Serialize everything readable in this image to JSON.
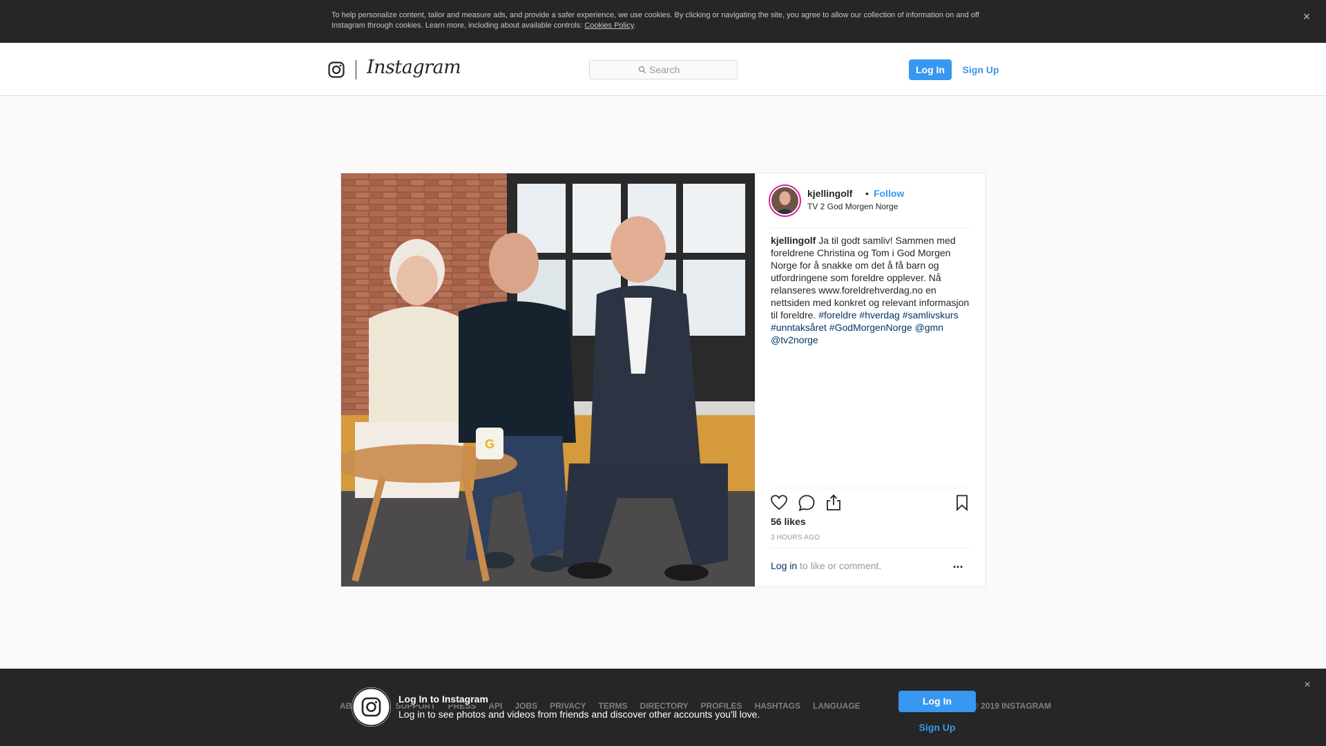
{
  "cookie_banner": {
    "text": "To help personalize content, tailor and measure ads, and provide a safer experience, we use cookies. By clicking or navigating the site, you agree to allow our collection of information on and off Instagram through cookies. Learn more, including about available controls: ",
    "link": "Cookies Policy",
    "end": ".",
    "close_icon": "×"
  },
  "header": {
    "wordmark": "Instagram",
    "search_placeholder": "Search",
    "login": "Log In",
    "signup": "Sign Up"
  },
  "post": {
    "username": "kjellingolf",
    "dot": "•",
    "follow": "Follow",
    "location": "TV 2 God Morgen Norge",
    "caption_user": "kjellingolf",
    "caption_text": " Ja til godt samliv! Sammen med foreldrene Christina og Tom i God Morgen Norge for å snakke om det å få barn og utfordringene som foreldre opplever. Nå relanseres www.foreldrehverdag.no en nettsiden med konkret og relevant informasjon til foreldre. ",
    "tags": [
      "#foreldre",
      "#hverdag",
      "#samlivskurs",
      "#unntaksåret",
      "#GodMorgenNorge",
      "@gmn",
      "@tv2norge"
    ],
    "likes": "56 likes",
    "time": "3 HOURS AGO",
    "login_link": "Log in",
    "login_rest": " to like or comment.",
    "more": "..."
  },
  "footer": {
    "links": [
      "ABOUT US",
      "SUPPORT",
      "PRESS",
      "API",
      "JOBS",
      "PRIVACY",
      "TERMS",
      "DIRECTORY",
      "PROFILES",
      "HASHTAGS",
      "LANGUAGE"
    ],
    "right": "© 2019 INSTAGRAM"
  },
  "login_bar": {
    "title": "Log In to Instagram",
    "subtitle": "Log in to see photos and videos from friends and discover other accounts you'll love.",
    "login": "Log In",
    "signup": "Sign Up",
    "close_icon": "×"
  }
}
